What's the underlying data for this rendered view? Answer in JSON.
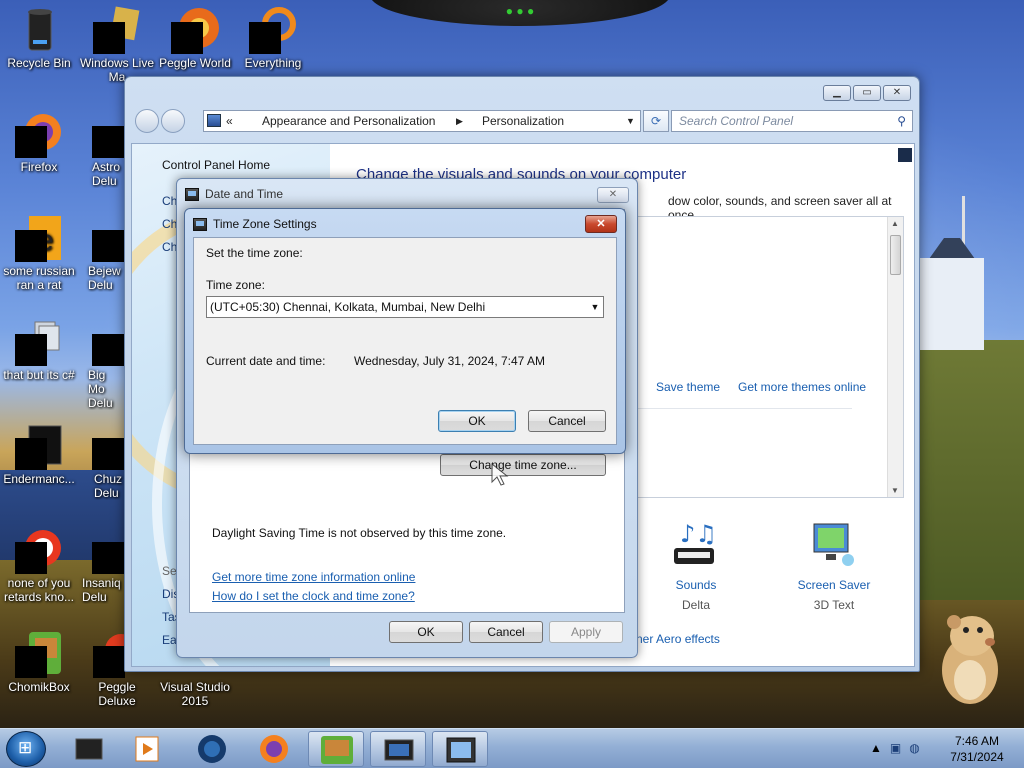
{
  "desktop_icons": [
    {
      "label": "Recycle Bin",
      "icon": "recycle-bin-icon"
    },
    {
      "label": "Windows Live Ma",
      "icon": "windows-live-icon"
    },
    {
      "label": "Peggle World",
      "icon": "peggle-world-icon"
    },
    {
      "label": "Everything",
      "icon": "everything-icon"
    },
    {
      "label": "Firefox",
      "icon": "firefox-icon"
    },
    {
      "label": "Astro Delu",
      "icon": "astro-icon"
    },
    {
      "label": "some russian ran a rat",
      "icon": "app-icon"
    },
    {
      "label": "Bejew Delu",
      "icon": "bejeweled-icon"
    },
    {
      "label": "that but its c#",
      "icon": "app-icon"
    },
    {
      "label": "Big Mo Delu",
      "icon": "game-icon"
    },
    {
      "label": "Endermanc...",
      "icon": "app-icon"
    },
    {
      "label": "Chuz Delu",
      "icon": "game-icon"
    },
    {
      "label": "none of you retards kno...",
      "icon": "app-icon"
    },
    {
      "label": "Insaniq Delu",
      "icon": "game-icon"
    },
    {
      "label": "ChomikBox",
      "icon": "chomikbox-icon"
    },
    {
      "label": "Peggle Deluxe",
      "icon": "peggle-icon"
    },
    {
      "label": "Visual Studio 2015",
      "icon": "visual-studio-icon"
    }
  ],
  "control_panel": {
    "breadcrumb_prefix": "«",
    "breadcrumb": [
      "Appearance and Personalization",
      "Personalization"
    ],
    "search_placeholder": "Search Control Panel",
    "left_pane": {
      "home": "Control Panel Home",
      "items": [
        "Ch",
        "Ch",
        "Ch"
      ],
      "see_also": [
        "Se",
        "Dis",
        "Tas",
        "Eas"
      ]
    },
    "heading": "Change the visuals and sounds on your computer",
    "subheading": "dow color, sounds, and screen saver all at once.",
    "save_theme": "Save theme",
    "get_more_themes": "Get more themes online",
    "sounds_label": "Sounds",
    "sounds_value": "Delta",
    "screensaver_label": "Screen Saver",
    "screensaver_value": "3D Text",
    "aero_link": "ner Aero effects"
  },
  "date_time_dialog": {
    "title": "Date and Time",
    "change_tz_button": "Change time zone...",
    "dst_text": "Daylight Saving Time is not observed by this time zone.",
    "link_more_info": "Get more time zone information online",
    "link_how": "How do I set the clock and time zone?",
    "ok": "OK",
    "cancel": "Cancel",
    "apply": "Apply"
  },
  "tz_dialog": {
    "title": "Time Zone Settings",
    "set_label": "Set the time zone:",
    "tz_label": "Time zone:",
    "tz_value": "(UTC+05:30) Chennai, Kolkata, Mumbai, New Delhi",
    "current_label": "Current date and time:",
    "current_value": "Wednesday, July 31, 2024, 7:47 AM",
    "ok": "OK",
    "cancel": "Cancel"
  },
  "taskbar": {
    "time": "7:46 AM",
    "date": "7/31/2024",
    "pinned": [
      "app-icon",
      "media-player-icon",
      "globe-icon",
      "firefox-icon",
      "chomikbox-icon",
      "control-panel-icon",
      "date-time-icon"
    ]
  },
  "colors": {
    "link": "#1a5fb0",
    "heading": "#1e3287",
    "close_red": "#c9492e"
  }
}
